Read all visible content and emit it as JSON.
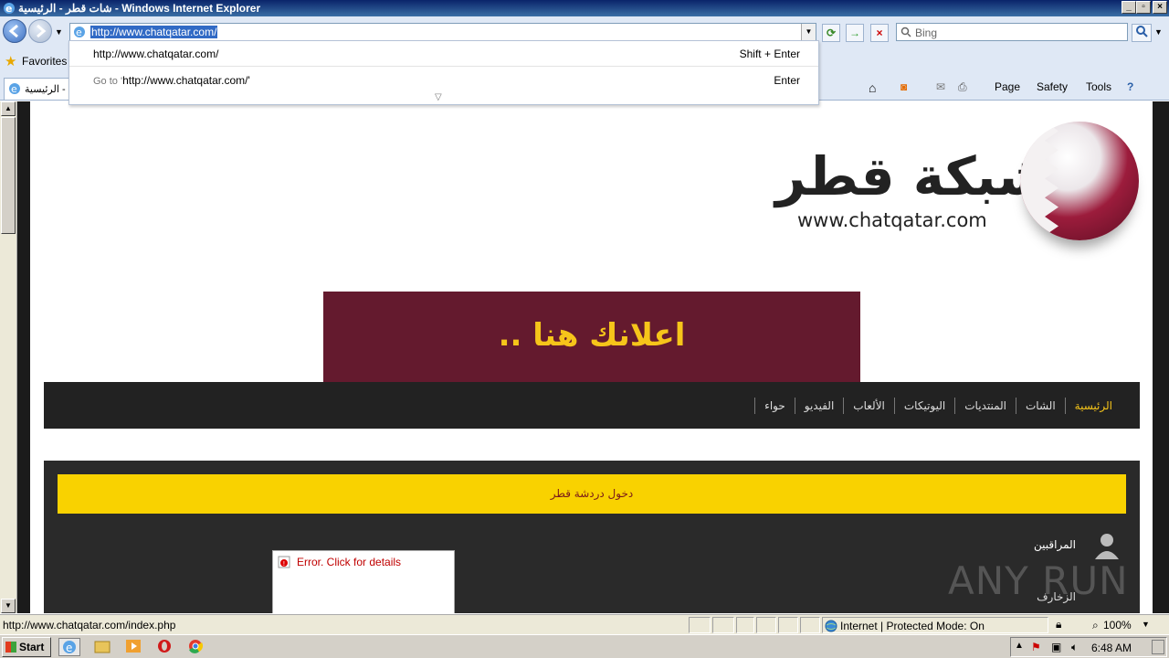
{
  "window": {
    "title": "شات قطر - الرئيسية - Windows Internet Explorer"
  },
  "navbar": {
    "address": "http://www.chatqatar.com/",
    "search_placeholder": "Bing"
  },
  "dropdown": {
    "row1_url": "http://www.chatqatar.com/",
    "row1_shortcut": "Shift + Enter",
    "row2_prefix": "Go to '",
    "row2_url": "http://www.chatqatar.com/",
    "row2_suffix": "'",
    "row2_shortcut": "Enter"
  },
  "favorites": {
    "label": "Favorites"
  },
  "tab": {
    "label": "الرئيسية - ..."
  },
  "commandbar": {
    "page": "Page",
    "safety": "Safety",
    "tools": "Tools"
  },
  "site": {
    "logo_text": "شبكة قطر",
    "logo_url": "www.chatqatar.com",
    "ad_text": "اعلانك هنا ..",
    "menu": [
      "الرئيسية",
      "الشات",
      "المنتديات",
      "اليوتيكات",
      "الألعاب",
      "الفيديو",
      "حواء"
    ],
    "enter_chat": "دخول دردشة قطر",
    "supervisors": "المراقبين",
    "decorations": "الزخارف",
    "error_text": "Error. Click for details",
    "watermark": "ANY RUN"
  },
  "statusbar": {
    "url": "http://www.chatqatar.com/index.php",
    "zone": "Internet | Protected Mode: On",
    "zoom": "100%"
  },
  "taskbar": {
    "start": "Start",
    "clock": "6:48 AM"
  },
  "colors": {
    "title_bar": "#0a246a",
    "ad_background": "#641a2e",
    "ad_text": "#f6c51a",
    "menu_bar": "#222222",
    "enter_bar": "#f9d200"
  }
}
